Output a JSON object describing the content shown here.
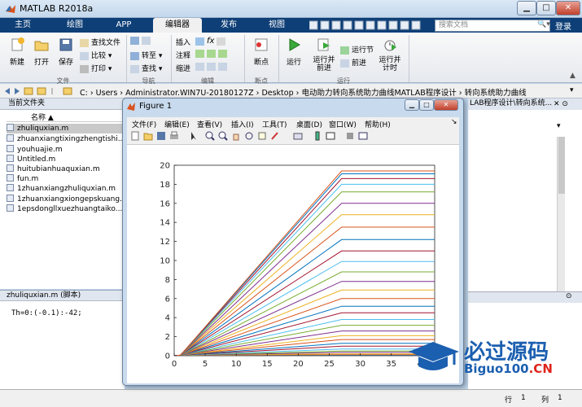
{
  "window": {
    "title": "MATLAB R2018a"
  },
  "tabs": [
    {
      "label": "主页"
    },
    {
      "label": "绘图"
    },
    {
      "label": "APP"
    },
    {
      "label": "编辑器"
    },
    {
      "label": "发布"
    },
    {
      "label": "视图"
    }
  ],
  "search": {
    "placeholder": "搜索文档"
  },
  "login": "登录",
  "ribbon": {
    "new": "新建",
    "open": "打开",
    "save": "保存",
    "find_files": "查找文件",
    "compare": "比较",
    "print": "打印",
    "goto": "转至",
    "find": "查找",
    "insert": "插入",
    "comment": "注释",
    "indent": "缩进",
    "fx": "fx",
    "breakpoints": "断点",
    "run": "运行",
    "run_advance": "运行并\n前进",
    "run_section": "运行节",
    "advance": "前进",
    "run_time": "运行并\n计时",
    "sections": [
      "文件",
      "导航",
      "编辑",
      "断点",
      "运行"
    ]
  },
  "address": {
    "path": "C:  ›  Users  ›  Administrator.WIN7U-20180127Z  ›  Desktop  ›  电动助力转向系统助力曲线MATLAB程序设计  ›  转向系统助力曲线"
  },
  "current_folder": {
    "label": "当前文件夹",
    "name_header": "名称 ▲",
    "files": [
      "zhuliquxian.m",
      "zhuanxiangtixingzhengtishi...",
      "youhuajie.m",
      "Untitled.m",
      "huitubianhuaquxian.m",
      "fun.m",
      "1zhuanxiangzhuliquxian.m",
      "1zhuanxiangxiongepskuang...",
      "1epsdongllxuezhuangtaiko..."
    ]
  },
  "details": {
    "header": "zhuliquxian.m  (脚本)",
    "code": "Th=0:(-0.1):-42;"
  },
  "editor": {
    "tab": "LAB程序设计\\转向系统..."
  },
  "status": {
    "row_label": "行",
    "row": "1",
    "col_label": "列",
    "col": "1"
  },
  "figure": {
    "title": "Figure 1",
    "menu": [
      "文件(F)",
      "编辑(E)",
      "查看(V)",
      "插入(I)",
      "工具(T)",
      "桌面(D)",
      "窗口(W)",
      "帮助(H)"
    ]
  },
  "watermark": {
    "text1": "必过源码",
    "text2": "Biguo100.CN"
  },
  "colors": {
    "tabbar": "#0e3f77",
    "accent": "#1b5fb0",
    "watermark_red": "#e0241b"
  },
  "chart_data": {
    "type": "line",
    "xlim": [
      0,
      42
    ],
    "ylim": [
      0,
      20
    ],
    "xticks": [
      0,
      5,
      10,
      15,
      20,
      25,
      30,
      35,
      40
    ],
    "yticks": [
      0,
      2,
      4,
      6,
      8,
      10,
      12,
      14,
      16,
      18,
      20
    ],
    "grid": false,
    "x": [
      0,
      1,
      27,
      42
    ],
    "plateau_levels": [
      0.05,
      0.1,
      0.2,
      0.35,
      0.5,
      0.7,
      1.0,
      1.3,
      1.7,
      2.1,
      2.6,
      3.2,
      3.8,
      4.5,
      5.2,
      6.0,
      6.9,
      7.8,
      8.8,
      9.9,
      11.0,
      12.2,
      13.5,
      14.8,
      16.0,
      17.2,
      18.0,
      18.6,
      19.1,
      19.4
    ],
    "series_colors": [
      "#0072bd",
      "#d95319",
      "#edb120",
      "#7e2f8e",
      "#77ac30",
      "#4dbeee",
      "#a2142f"
    ]
  }
}
